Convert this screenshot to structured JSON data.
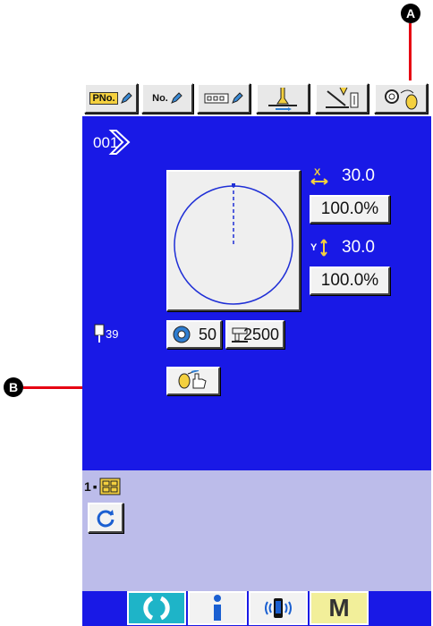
{
  "markers": {
    "a": "A",
    "b": "B"
  },
  "toolbar": {
    "pno_label": "PNo.",
    "no_label": "No."
  },
  "pattern": {
    "number": "001"
  },
  "x_axis": {
    "value": "30.0",
    "scale": "100.0%"
  },
  "y_axis": {
    "value": "30.0",
    "scale": "100.0%"
  },
  "needle_count": "39",
  "thread_tension": "50",
  "max_speed": "2500",
  "counter": {
    "prefix": "1"
  },
  "bottom": {
    "mode_label": "M"
  },
  "colors": {
    "blue_panel": "#1919e6",
    "lavender_panel": "#bcbcea",
    "callout_red": "#e60012",
    "ready_cyan": "#1eb4c8",
    "mode_yellow": "#f2ef9a"
  }
}
